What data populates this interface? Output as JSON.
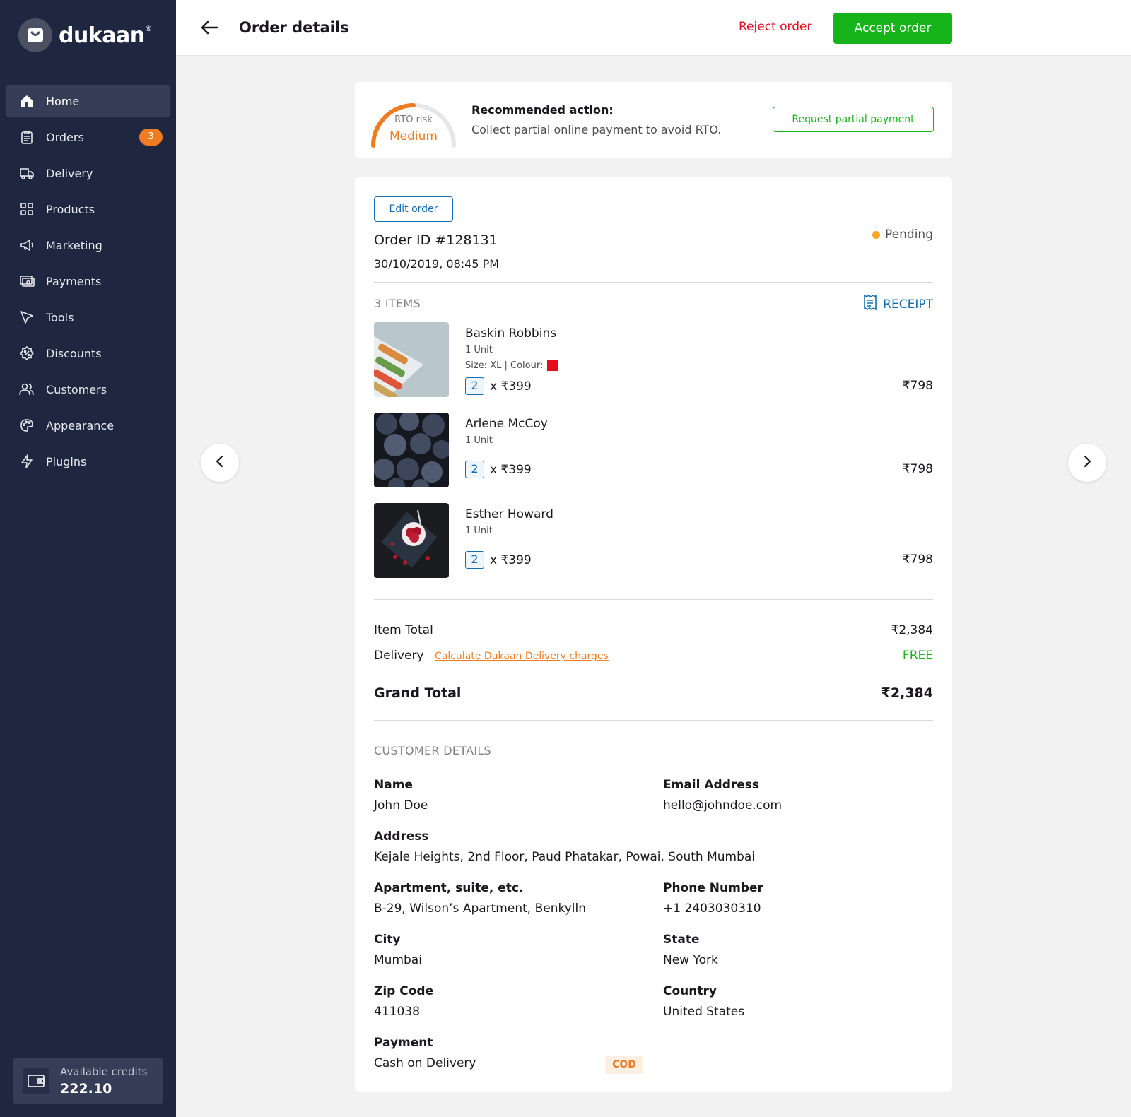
{
  "brand": {
    "name": "dukaan",
    "reg": "®"
  },
  "sidebar": {
    "items": [
      {
        "label": "Home",
        "icon": "home-icon",
        "active": true
      },
      {
        "label": "Orders",
        "icon": "orders-icon",
        "badge": "3"
      },
      {
        "label": "Delivery",
        "icon": "truck-icon"
      },
      {
        "label": "Products",
        "icon": "grid-icon"
      },
      {
        "label": "Marketing",
        "icon": "megaphone-icon"
      },
      {
        "label": "Payments",
        "icon": "payments-icon"
      },
      {
        "label": "Tools",
        "icon": "cursor-icon"
      },
      {
        "label": "Discounts",
        "icon": "discount-icon"
      },
      {
        "label": "Customers",
        "icon": "users-icon"
      },
      {
        "label": "Appearance",
        "icon": "palette-icon"
      },
      {
        "label": "Plugins",
        "icon": "bolt-icon"
      }
    ],
    "credits": {
      "label": "Available credits",
      "value": "222.10"
    }
  },
  "header": {
    "title": "Order details",
    "reject_label": "Reject order",
    "accept_label": "Accept order"
  },
  "rto": {
    "label": "RTO risk",
    "level": "Medium",
    "gauge_fraction": 0.5,
    "rec_title": "Recommended action:",
    "rec_text": "Collect partial online payment to avoid RTO.",
    "button": "Request partial payment"
  },
  "order": {
    "edit_label": "Edit order",
    "id": "Order ID #128131",
    "date": "30/10/2019, 08:45 PM",
    "status": "Pending",
    "items_count": "3 ITEMS",
    "receipt_label": "RECEIPT",
    "items": [
      {
        "name": "Baskin Robbins",
        "unit": "1 Unit",
        "attr": "Size: XL | Colour:",
        "swatch": "#e50b20",
        "qty": "2",
        "price": "x ₹399",
        "total": "₹798"
      },
      {
        "name": "Arlene McCoy",
        "unit": "1 Unit",
        "qty": "2",
        "price": "x ₹399",
        "total": "₹798"
      },
      {
        "name": "Esther Howard",
        "unit": "1 Unit",
        "qty": "2",
        "price": "x ₹399",
        "total": "₹798"
      }
    ],
    "item_total_label": "Item Total",
    "item_total": "₹2,384",
    "delivery_label": "Delivery",
    "delivery_link": "Calculate Dukaan Delivery charges",
    "delivery_value": "FREE",
    "grand_label": "Grand Total",
    "grand_value": "₹2,384"
  },
  "customer": {
    "title": "CUSTOMER DETAILS",
    "name_label": "Name",
    "name": "John Doe",
    "email_label": "Email Address",
    "email": "hello@johndoe.com",
    "address_label": "Address",
    "address": "Kejale Heights, 2nd Floor, Paud Phatakar, Powai, South Mumbai",
    "apt_label": "Apartment, suite, etc.",
    "apt": "B-29, Wilson’s Apartment, Benkylln",
    "phone_label": "Phone Number",
    "phone": "+1 2403030310",
    "city_label": "City",
    "city": "Mumbai",
    "state_label": "State",
    "state": "New York",
    "zip_label": "Zip Code",
    "zip": "411038",
    "country_label": "Country",
    "country": "United States",
    "payment_label": "Payment",
    "payment": "Cash on Delivery",
    "payment_badge": "COD"
  },
  "colors": {
    "sidebar": "#1e2640",
    "accent": "#146eb4",
    "success": "#17b31b",
    "danger": "#e50b20",
    "warning": "#f07c22"
  }
}
